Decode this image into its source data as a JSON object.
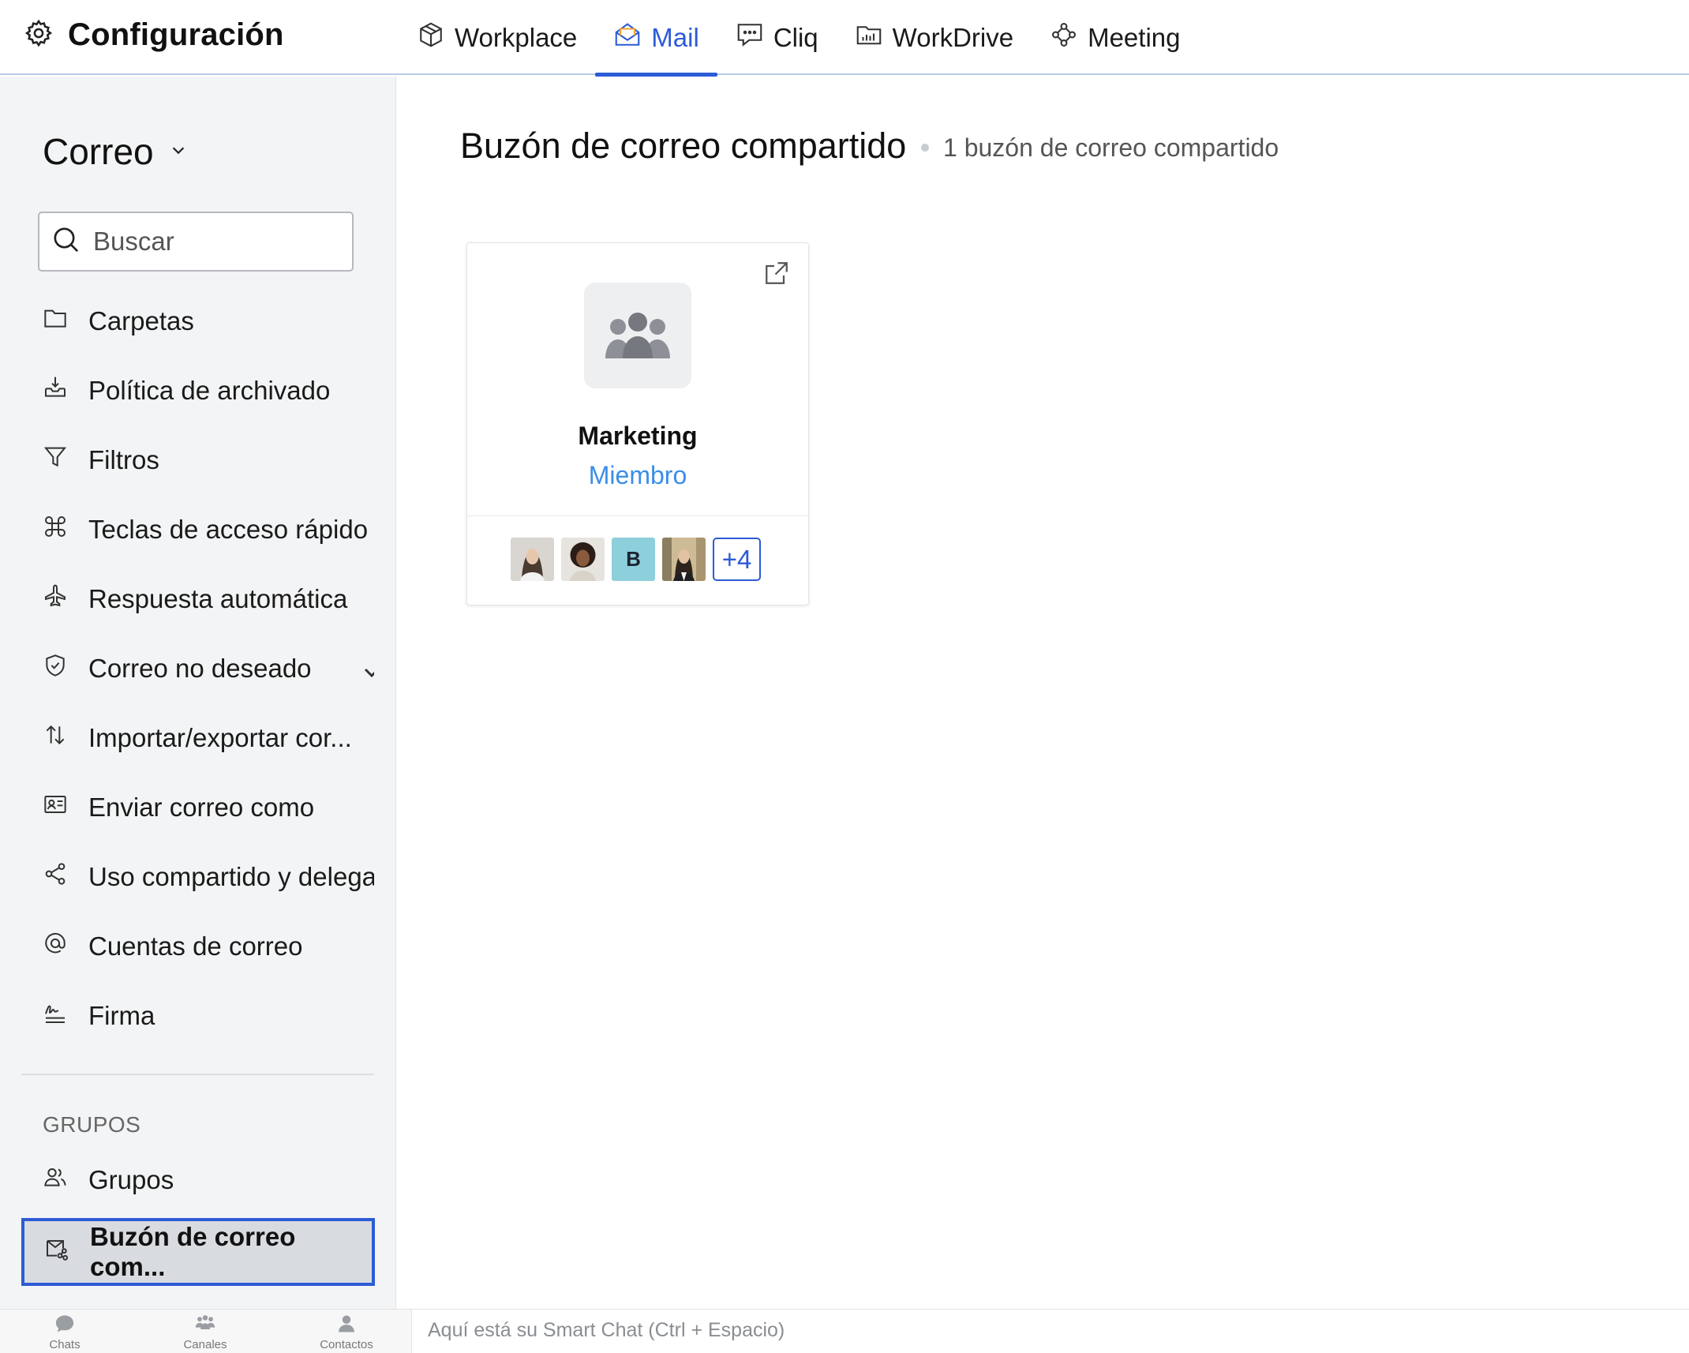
{
  "header": {
    "title": "Configuración",
    "tabs": [
      {
        "label": "Workplace",
        "icon": "box-icon"
      },
      {
        "label": "Mail",
        "icon": "mail-open-icon",
        "active": true
      },
      {
        "label": "Cliq",
        "icon": "chat-bubble-icon"
      },
      {
        "label": "WorkDrive",
        "icon": "drive-folder-icon"
      },
      {
        "label": "Meeting",
        "icon": "meeting-icon"
      }
    ]
  },
  "sidebar": {
    "title": "Correo",
    "search_placeholder": "Buscar",
    "items": [
      {
        "label": "Carpetas",
        "icon": "folder-icon"
      },
      {
        "label": "Política de archivado",
        "icon": "archive-tray-icon"
      },
      {
        "label": "Filtros",
        "icon": "filter-icon"
      },
      {
        "label": "Teclas de acceso rápido",
        "icon": "command-key-icon"
      },
      {
        "label": "Respuesta automática",
        "icon": "airplane-icon"
      },
      {
        "label": "Correo no deseado",
        "icon": "shield-check-icon",
        "expandable": true
      },
      {
        "label": "Importar/exportar cor...",
        "icon": "arrows-updown-icon"
      },
      {
        "label": "Enviar correo como",
        "icon": "id-card-icon"
      },
      {
        "label": "Uso compartido y delegac",
        "icon": "share-icon"
      },
      {
        "label": "Cuentas de correo",
        "icon": "at-sign-icon"
      },
      {
        "label": "Firma",
        "icon": "signature-icon"
      }
    ],
    "groups_section": "GRUPOS",
    "groups_items": [
      {
        "label": "Grupos",
        "icon": "users-icon"
      }
    ],
    "selected_item": {
      "label": "Buzón de correo com...",
      "icon": "shared-mailbox-icon"
    }
  },
  "main": {
    "title": "Buzón de correo compartido",
    "subtitle": "1 buzón de correo compartido",
    "card": {
      "name": "Marketing",
      "role": "Miembro",
      "members": [
        {
          "type": "photo",
          "icon": "avatar-photo-woman-1"
        },
        {
          "type": "photo",
          "icon": "avatar-photo-woman-2"
        },
        {
          "type": "initial",
          "initial": "B",
          "color": "#8ecfdc"
        },
        {
          "type": "photo",
          "icon": "avatar-photo-woman-3"
        }
      ],
      "more_count": "+4"
    }
  },
  "bottombar": {
    "items": [
      {
        "label": "Chats",
        "icon": "chat-icon"
      },
      {
        "label": "Canales",
        "icon": "channels-icon"
      },
      {
        "label": "Contactos",
        "icon": "contact-icon"
      }
    ],
    "smartchat_placeholder": "Aquí está su Smart Chat (Ctrl + Espacio)"
  },
  "colors": {
    "accent": "#2c5bd6",
    "link": "#3a8ee6",
    "sidebar_bg": "#f3f4f5"
  }
}
